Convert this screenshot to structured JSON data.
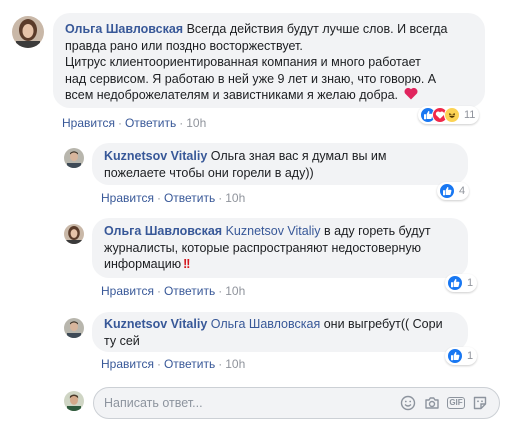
{
  "comments": [
    {
      "author": "Ольга Шавловская",
      "lines": [
        "Всегда действия будут лучше слов. И всегда",
        "правда рано или поздно восторжествует.",
        "Цитрус клиентоориентированная компания и много работает",
        "над сервисом. Я работаю в ней уже 9 лет и знаю, что говорю. А",
        "всем недоброжелателям и завистниками я желаю добра."
      ],
      "like_label": "Нравится",
      "reply_label": "Ответить",
      "time": "10h",
      "reactions": [
        "like",
        "love",
        "haha"
      ],
      "reaction_count": "11"
    },
    {
      "author": "Kuznetsov Vitaliy",
      "lines": [
        "Ольга зная вас я думал вы им",
        "пожелаете чтобы они горели в аду))"
      ],
      "like_label": "Нравится",
      "reply_label": "Ответить",
      "time": "10h",
      "reactions": [
        "like"
      ],
      "reaction_count": "4"
    },
    {
      "author": "Ольга Шавловская",
      "mention": "Kuznetsov Vitaliy",
      "lines": [
        "в аду гореть будут",
        "журналисты, которые распространяют недостоверную",
        "информацию"
      ],
      "like_label": "Нравится",
      "reply_label": "Ответить",
      "time": "10h",
      "reactions": [
        "like"
      ],
      "reaction_count": "1"
    },
    {
      "author": "Kuznetsov Vitaliy",
      "mention": "Ольга Шавловская",
      "lines": [
        "они выгребут(( Сори",
        "ту сей"
      ],
      "like_label": "Нравится",
      "reply_label": "Ответить",
      "time": "10h",
      "reactions": [
        "like"
      ],
      "reaction_count": "1"
    }
  ],
  "reply": {
    "placeholder": "Написать ответ...",
    "tools": [
      "emoji-icon",
      "camera-icon",
      "gif-icon",
      "sticker-icon"
    ]
  },
  "colors": {
    "link": "#385898",
    "bubble": "#f2f3f5",
    "meta": "#90949c",
    "like": "#1877f2",
    "love": "#f0284a",
    "haha": "#fcd354"
  }
}
